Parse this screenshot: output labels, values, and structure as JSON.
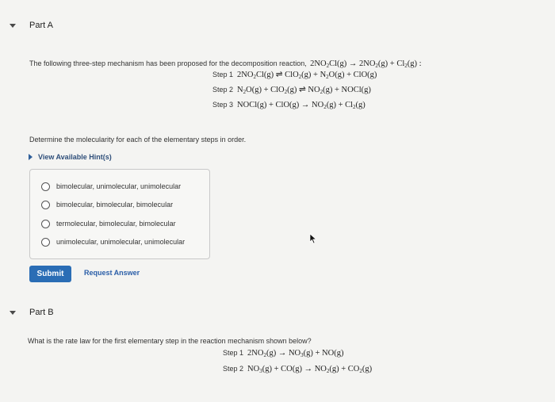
{
  "partA": {
    "title": "Part A",
    "intro": "The following three-step mechanism has been proposed for the decomposition reaction,",
    "overall_reaction": [
      "2NO",
      "2",
      "Cl(g) → 2NO",
      "2",
      "(g) + Cl",
      "2",
      "(g) :"
    ],
    "steps": [
      {
        "label": "Step 1",
        "parts": [
          "2NO",
          "2",
          "Cl(g) ⇌ ClO",
          "2",
          "(g) + N",
          "2",
          "O(g) + ClO(g)"
        ]
      },
      {
        "label": "Step 2",
        "parts": [
          "N",
          "2",
          "O(g) + ClO",
          "2",
          "(g) ⇌ NO",
          "2",
          "(g) + NOCl(g)"
        ]
      },
      {
        "label": "Step 3",
        "parts": [
          "NOCl(g) + ClO(g) → NO",
          "2",
          "(g) + Cl",
          "2",
          "(g)"
        ]
      }
    ],
    "question": "Determine the molecularity for each of the elementary steps in order.",
    "hint_label": "View Available Hint(s)",
    "choices": [
      "bimolecular, unimolecular, unimolecular",
      "bimolecular, bimolecular, bimolecular",
      "termolecular, bimolecular, bimolecular",
      "unimolecular, unimolecular, unimolecular"
    ],
    "submit_label": "Submit",
    "request_answer_label": "Request Answer"
  },
  "partB": {
    "title": "Part B",
    "question": "What is the rate law for the first elementary step in the reaction mechanism shown below?",
    "steps": [
      {
        "label": "Step 1",
        "parts": [
          "2NO",
          "2",
          "(g) → NO",
          "3",
          "(g) + NO(g)"
        ]
      },
      {
        "label": "Step 2",
        "parts": [
          "NO",
          "3",
          "(g) + CO(g) → NO",
          "2",
          "(g) + CO",
          "2",
          "(g)"
        ]
      }
    ]
  }
}
